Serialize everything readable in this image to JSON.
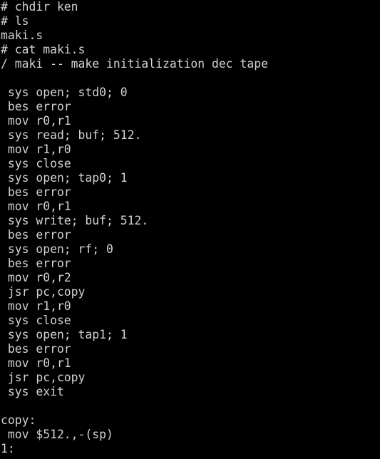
{
  "terminal": {
    "lines": [
      "# chdir ken",
      "# ls",
      "maki.s",
      "# cat maki.s",
      "/ maki -- make initialization dec tape",
      "",
      " sys open; std0; 0",
      " bes error",
      " mov r0,r1",
      " sys read; buf; 512.",
      " mov r1,r0",
      " sys close",
      " sys open; tap0; 1",
      " bes error",
      " mov r0,r1",
      " sys write; buf; 512.",
      " bes error",
      " sys open; rf; 0",
      " bes error",
      " mov r0,r2",
      " jsr pc,copy",
      " mov r1,r0",
      " sys close",
      " sys open; tap1; 1",
      " bes error",
      " mov r0,r1",
      " jsr pc,copy",
      " sys exit",
      "",
      "copy:",
      " mov $512.,-(sp)",
      "1:"
    ]
  }
}
